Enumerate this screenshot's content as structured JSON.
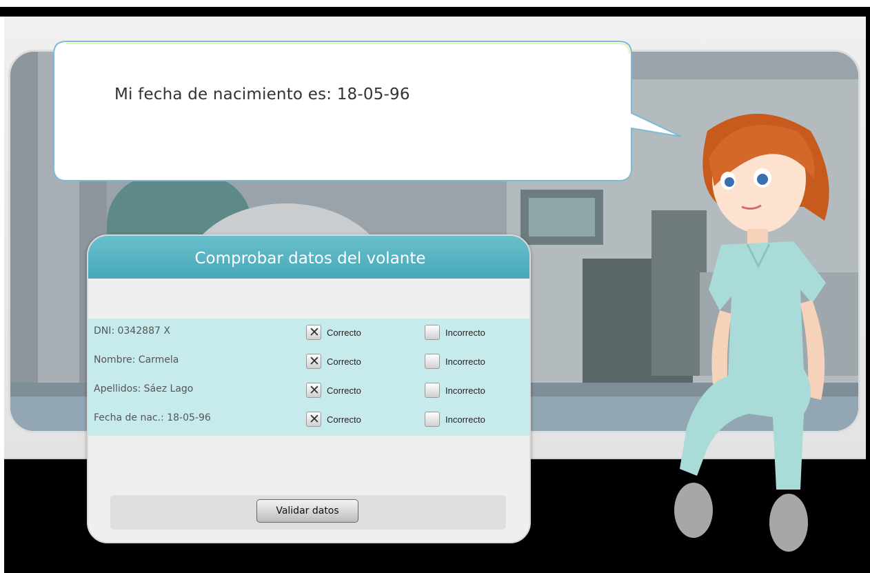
{
  "speech": {
    "label": "Mi fecha de nacimiento es:",
    "value": "18-05-96"
  },
  "panel": {
    "title": "Comprobar datos del volante",
    "option_correct": "Correcto",
    "option_incorrect": "Incorrecto",
    "validate_label": "Validar datos",
    "rows": [
      {
        "label": "DNI: 0342887 X",
        "correct_checked": true,
        "incorrect_checked": false
      },
      {
        "label": "Nombre:  Carmela",
        "correct_checked": true,
        "incorrect_checked": false
      },
      {
        "label": "Apellidos: Sáez Lago",
        "correct_checked": true,
        "incorrect_checked": false
      },
      {
        "label": "Fecha de nac.: 18-05-96",
        "correct_checked": true,
        "incorrect_checked": false
      }
    ],
    "check_mark": "✕"
  },
  "colors": {
    "header": "#4fb3c1",
    "rows_bg": "#c7eaed",
    "panel_bg": "#efefef"
  }
}
